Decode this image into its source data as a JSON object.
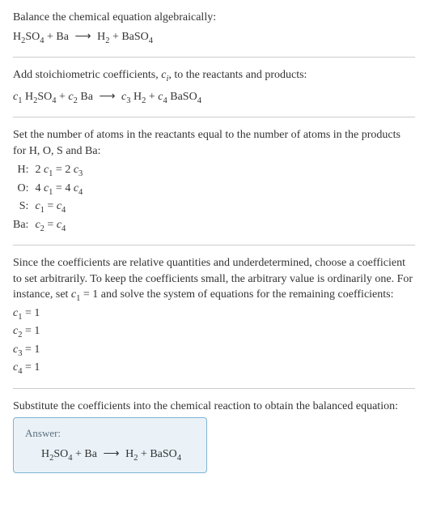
{
  "intro": {
    "line1": "Balance the chemical equation algebraically:",
    "eq": "H₂SO₄ + Ba ⟶ H₂ + BaSO₄"
  },
  "step1": {
    "text": "Add stoichiometric coefficients, cᵢ, to the reactants and products:",
    "eq": "c₁ H₂SO₄ + c₂ Ba ⟶ c₃ H₂ + c₄ BaSO₄"
  },
  "step2": {
    "text": "Set the number of atoms in the reactants equal to the number of atoms in the products for H, O, S and Ba:",
    "rows": [
      {
        "label": "H:",
        "eq": "2 c₁ = 2 c₃"
      },
      {
        "label": "O:",
        "eq": "4 c₁ = 4 c₄"
      },
      {
        "label": "S:",
        "eq": "c₁ = c₄"
      },
      {
        "label": "Ba:",
        "eq": "c₂ = c₄"
      }
    ]
  },
  "step3": {
    "text": "Since the coefficients are relative quantities and underdetermined, choose a coefficient to set arbitrarily. To keep the coefficients small, the arbitrary value is ordinarily one. For instance, set c₁ = 1 and solve the system of equations for the remaining coefficients:",
    "lines": [
      "c₁ = 1",
      "c₂ = 1",
      "c₃ = 1",
      "c₄ = 1"
    ]
  },
  "step4": {
    "text": "Substitute the coefficients into the chemical reaction to obtain the balanced equation:"
  },
  "answer": {
    "label": "Answer:",
    "eq": "H₂SO₄ + Ba ⟶ H₂ + BaSO₄"
  }
}
